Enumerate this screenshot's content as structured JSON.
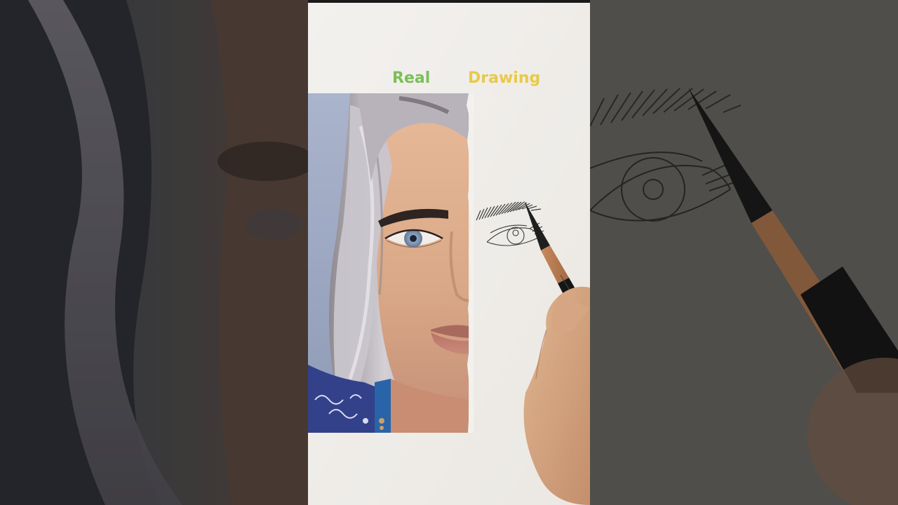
{
  "labels": {
    "real": "Real",
    "drawing": "Drawing"
  },
  "colors": {
    "real_label": "#7cbf5a",
    "drawing_label": "#e8c94a",
    "paper": "#f2f0ec",
    "backdrop": "#3c3a38"
  }
}
